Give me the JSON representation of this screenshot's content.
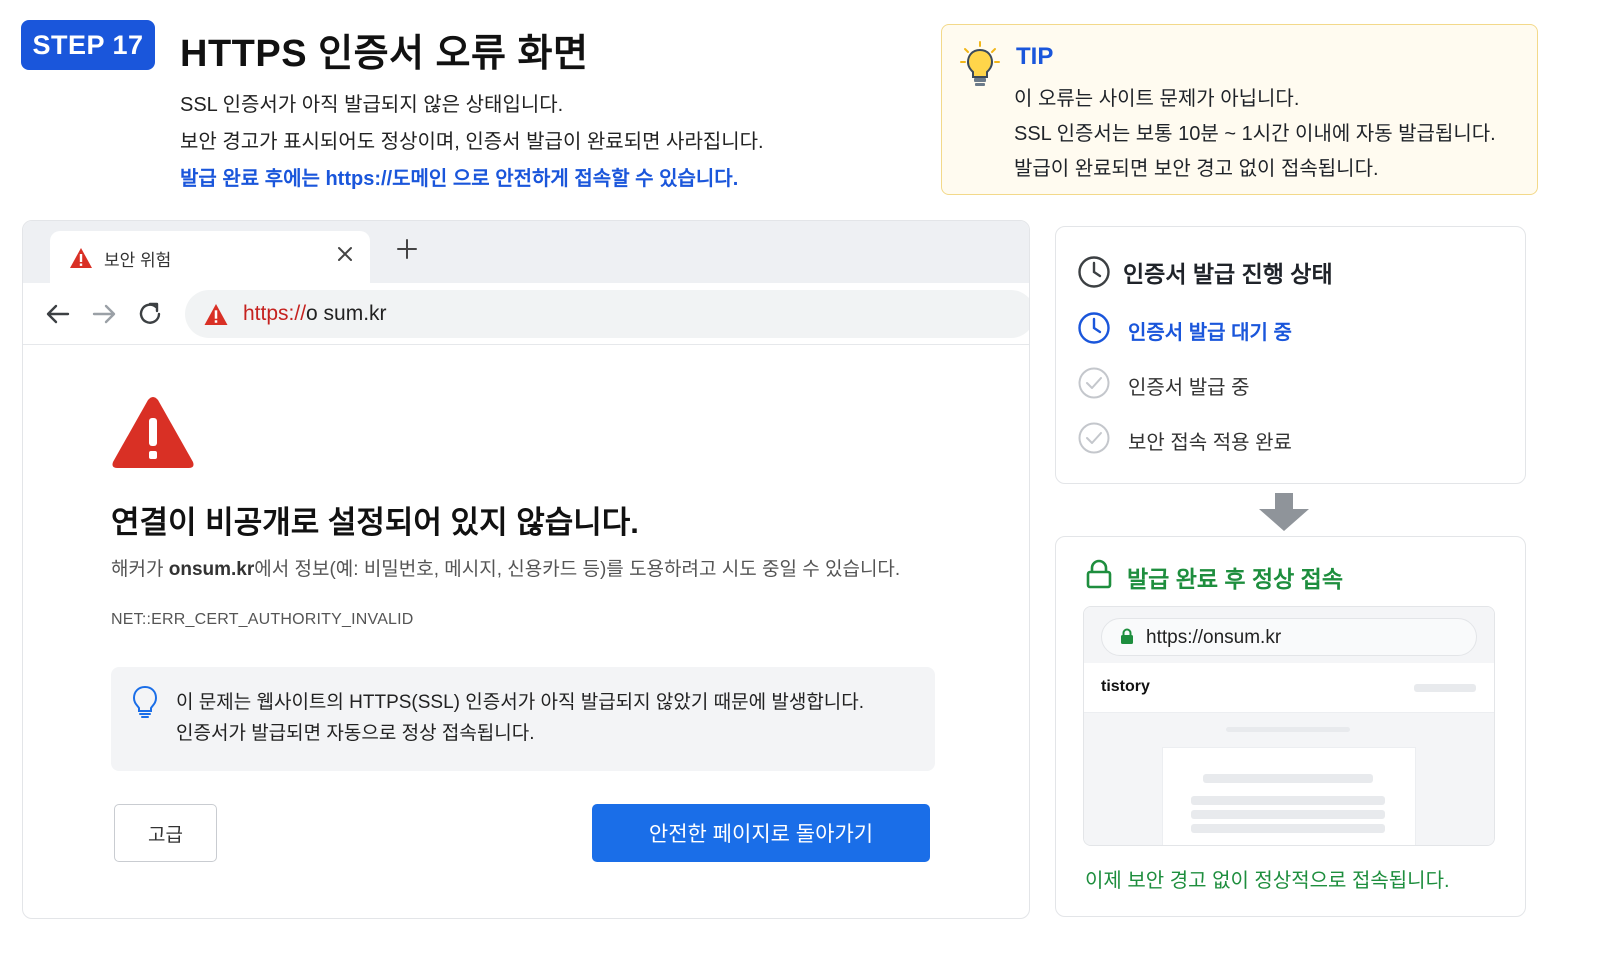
{
  "header": {
    "step_badge": "STEP 17",
    "title": "HTTPS 인증서 오류 화면",
    "lines": [
      "SSL 인증서가 아직 발급되지 않은 상태입니다.",
      "보안 경고가 표시되어도 정상이며, 인증서 발급이 완료되면 사라집니다.",
      "발급 완료 후에는 https://도메인 으로 안전하게 접속할 수 있습니다."
    ]
  },
  "tip": {
    "icon": "lightbulb-icon",
    "title": "TIP",
    "lines": [
      "이 오류는 사이트 문제가 아닙니다.",
      "SSL 인증서는 보통 10분 ~ 1시간 이내에 자동 발급됩니다.",
      "발급이 완료되면 보안 경고 없이 접속됩니다."
    ]
  },
  "browser": {
    "tab_title": "보안 위험",
    "url_scheme": "https://",
    "url_host": "o  sum.kr",
    "error": {
      "title": "연결이 비공개로 설정되어 있지 않습니다.",
      "desc_prefix": "해커가 ",
      "desc_domain": "onsum.kr",
      "desc_suffix": "에서 정보(예: 비밀번호, 메시지, 신용카드 등)를 도용하려고 시도 중일 수 있습니다.",
      "code": "NET::ERR_CERT_AUTHORITY_INVALID"
    },
    "hint_lines": [
      "이 문제는 웹사이트의 HTTPS(SSL) 인증서가 아직 발급되지 않았기 때문에 발생합니다.",
      "인증서가 발급되면 자동으로 정상 접속됩니다."
    ],
    "advanced_button": "고급",
    "back_button": "안전한 페이지로 돌아가기"
  },
  "status": {
    "title": "인증서 발급 진행 상태",
    "steps": [
      {
        "label": "인증서 발급 대기 중",
        "state": "active"
      },
      {
        "label": "인증서 발급 중",
        "state": "pending"
      },
      {
        "label": "보안 접속 적용 완료",
        "state": "pending"
      }
    ]
  },
  "done": {
    "title": "발급 완료 후 정상 접속",
    "url": "https://onsum.kr",
    "site_name": "tistory",
    "footer": "이제 보안 경고 없이 정상적으로 접속됩니다."
  },
  "colors": {
    "primary": "#1a56db",
    "danger": "#d93025",
    "success": "#1e8e3e"
  }
}
